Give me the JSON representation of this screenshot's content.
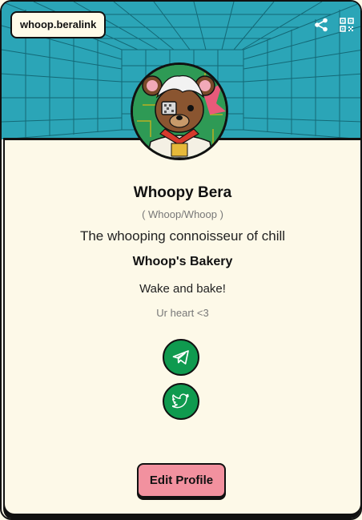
{
  "header": {
    "handle": "whoop.beralink",
    "share_icon": "share-icon",
    "qr_icon": "qr-code-icon"
  },
  "profile": {
    "name": "Whoopy Bera",
    "username": "( Whoop/Whoop )",
    "tagline": "The whooping connoisseur of chill",
    "business": "Whoop's Bakery",
    "motto": "Wake and bake!",
    "signoff": "Ur heart <3"
  },
  "links": [
    {
      "icon": "telegram-icon"
    },
    {
      "icon": "twitter-icon"
    }
  ],
  "actions": {
    "edit_label": "Edit Profile"
  },
  "colors": {
    "banner": "#2aa6b8",
    "card": "#fdf9e8",
    "social": "#0f9a4f",
    "edit_button": "#f2919f"
  }
}
